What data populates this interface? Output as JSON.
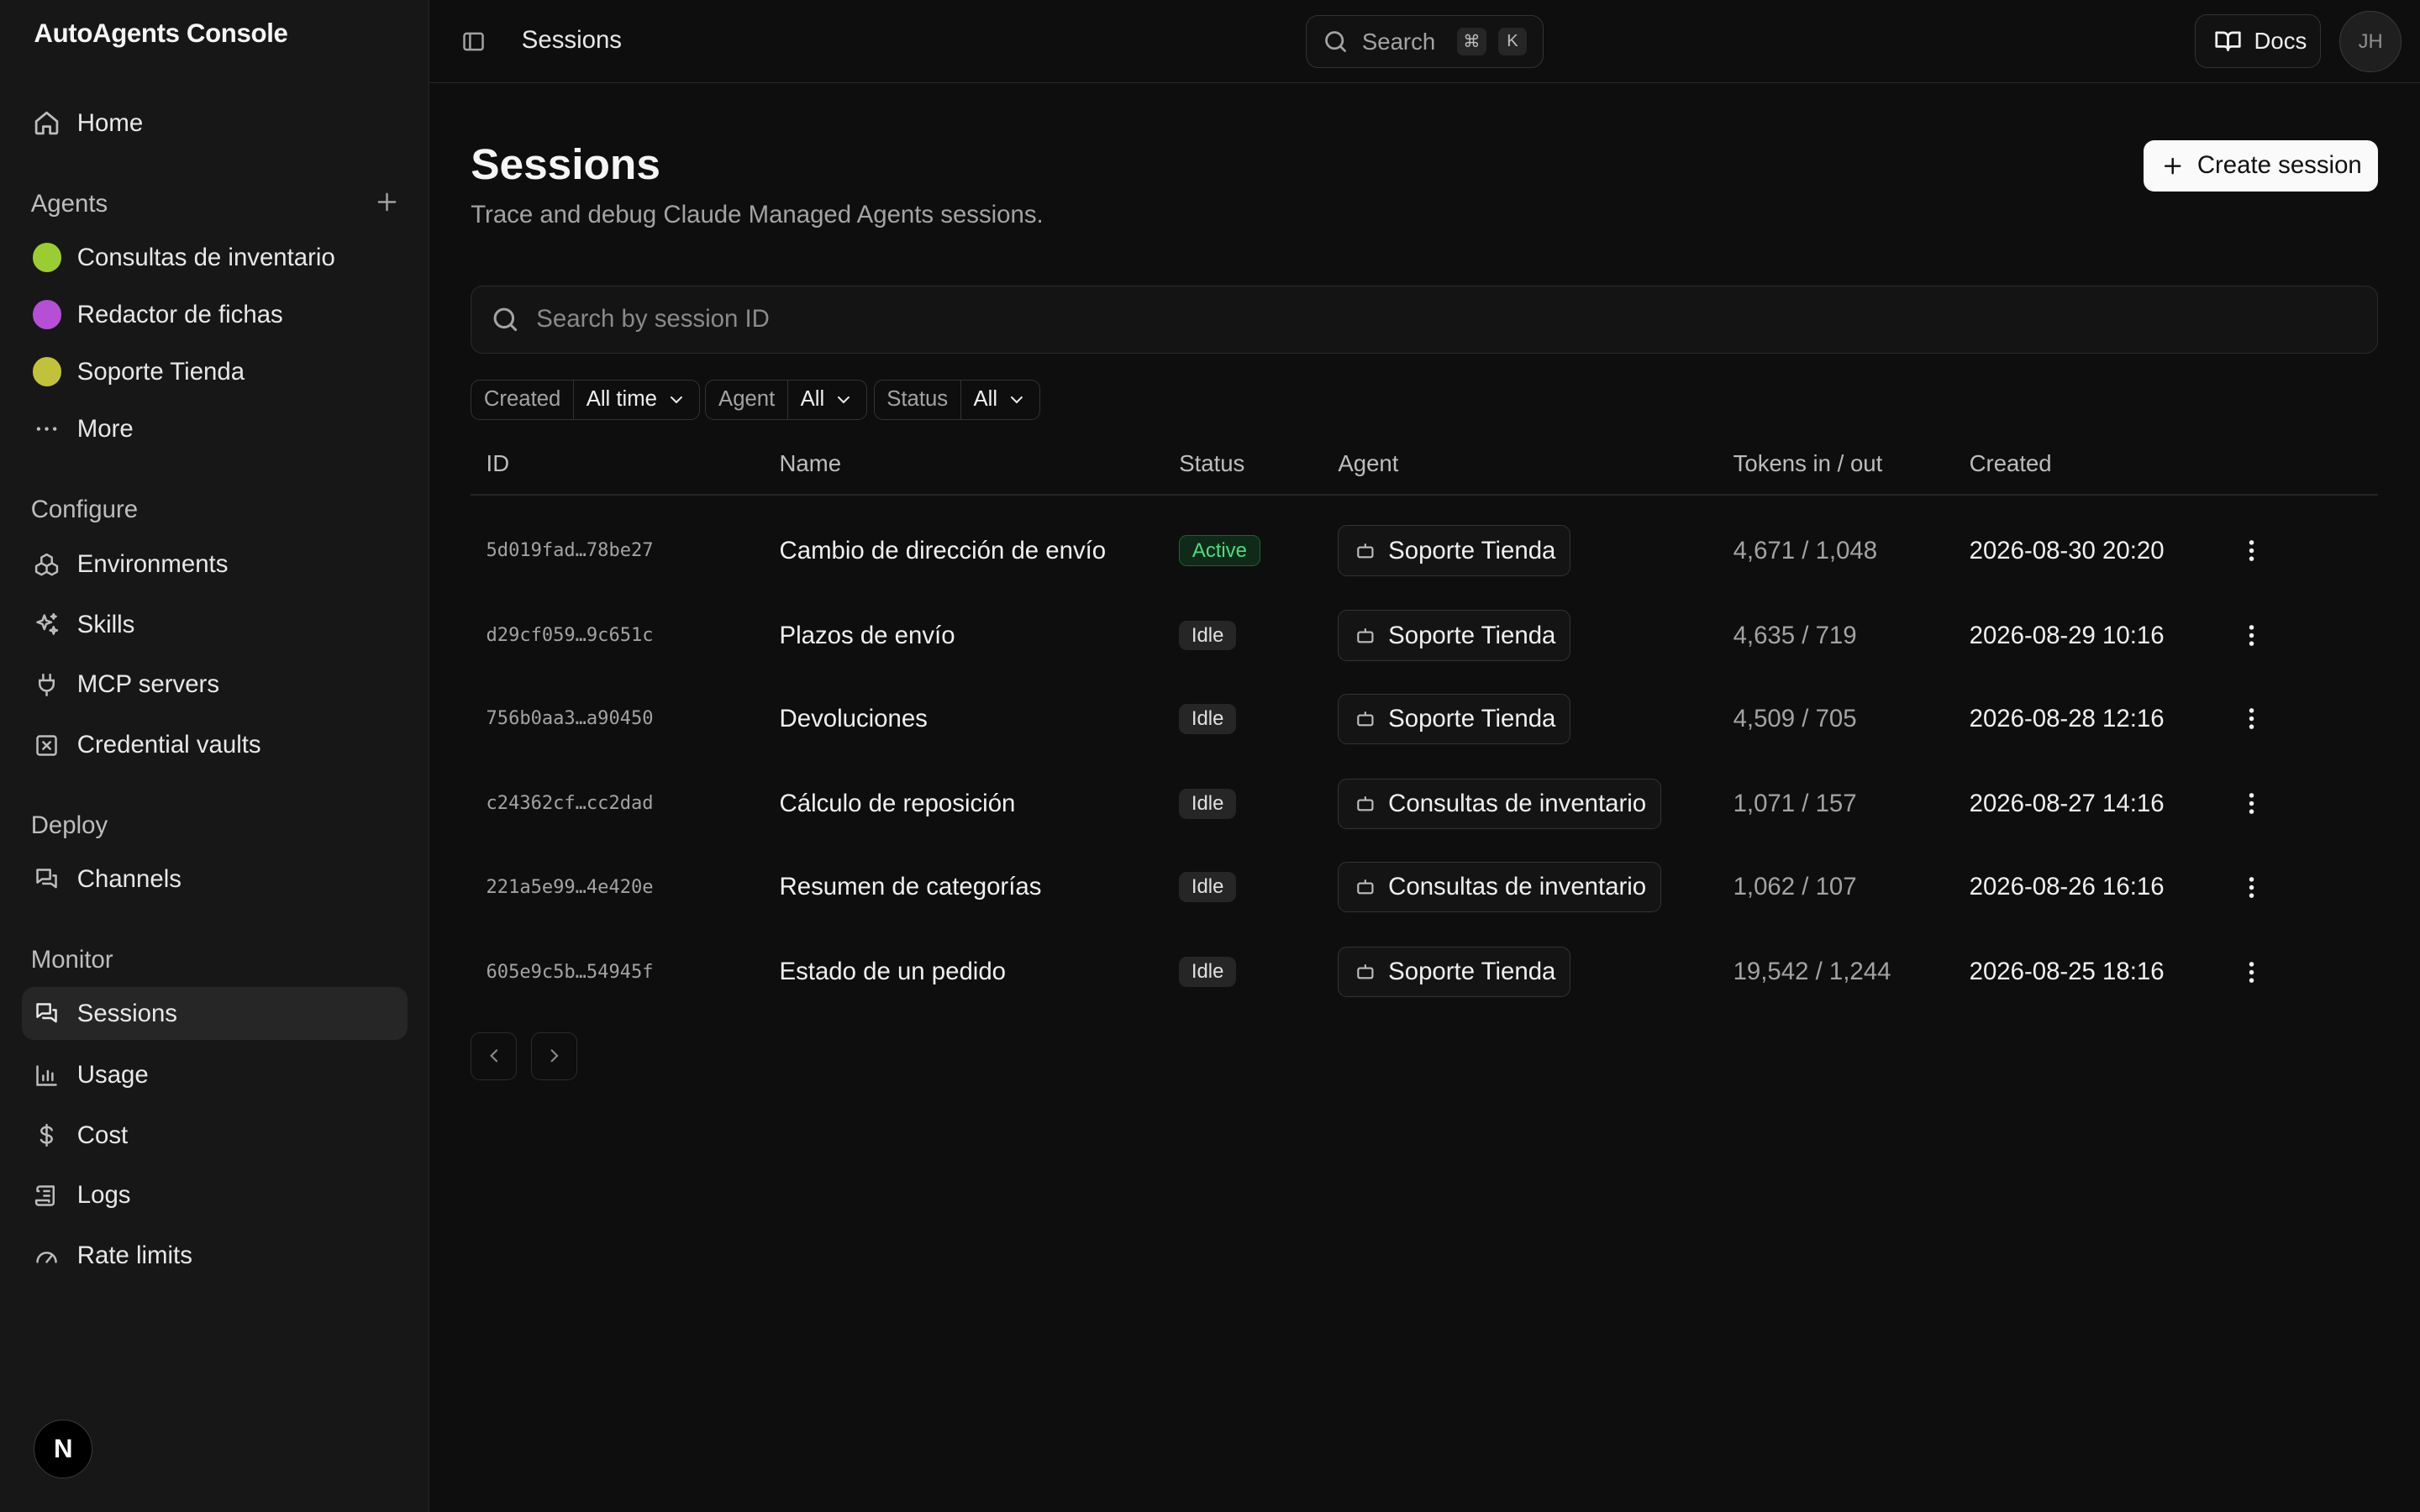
{
  "app": {
    "title": "AutoAgents Console"
  },
  "sidebar": {
    "home_label": "Home",
    "agents_title": "Agents",
    "agents": [
      {
        "label": "Consultas de inventario",
        "color": "#9acd32"
      },
      {
        "label": "Redactor de fichas",
        "color": "#b44fd6"
      },
      {
        "label": "Soporte Tienda",
        "color": "#c2c23a"
      }
    ],
    "more_label": "More",
    "configure_title": "Configure",
    "configure_items": [
      "Environments",
      "Skills",
      "MCP servers",
      "Credential vaults"
    ],
    "deploy_title": "Deploy",
    "deploy_items": [
      "Channels"
    ],
    "monitor_title": "Monitor",
    "monitor_items": [
      "Sessions",
      "Usage",
      "Cost",
      "Logs",
      "Rate limits"
    ],
    "badge_letter": "N"
  },
  "topbar": {
    "breadcrumb": "Sessions",
    "search_label": "Search",
    "search_kbd1": "⌘",
    "search_kbd2": "K",
    "docs_label": "Docs",
    "avatar_initials": "JH"
  },
  "page": {
    "title": "Sessions",
    "subtitle": "Trace and debug Claude Managed Agents sessions.",
    "create_label": "Create session",
    "search_placeholder": "Search by session ID"
  },
  "filters": [
    {
      "label": "Created",
      "value": "All time"
    },
    {
      "label": "Agent",
      "value": "All"
    },
    {
      "label": "Status",
      "value": "All"
    }
  ],
  "table": {
    "columns": [
      "ID",
      "Name",
      "Status",
      "Agent",
      "Tokens in / out",
      "Created"
    ],
    "rows": [
      {
        "id": "5d019fad…78be27",
        "name": "Cambio de dirección de envío",
        "status": "Active",
        "agent": "Soporte Tienda",
        "tokens": "4,671 / 1,048",
        "created": "2026-08-30 20:20"
      },
      {
        "id": "d29cf059…9c651c",
        "name": "Plazos de envío",
        "status": "Idle",
        "agent": "Soporte Tienda",
        "tokens": "4,635 / 719",
        "created": "2026-08-29 10:16"
      },
      {
        "id": "756b0aa3…a90450",
        "name": "Devoluciones",
        "status": "Idle",
        "agent": "Soporte Tienda",
        "tokens": "4,509 / 705",
        "created": "2026-08-28 12:16"
      },
      {
        "id": "c24362cf…cc2dad",
        "name": "Cálculo de reposición",
        "status": "Idle",
        "agent": "Consultas de inventario",
        "tokens": "1,071 / 157",
        "created": "2026-08-27 14:16"
      },
      {
        "id": "221a5e99…4e420e",
        "name": "Resumen de categorías",
        "status": "Idle",
        "agent": "Consultas de inventario",
        "tokens": "1,062 / 107",
        "created": "2026-08-26 16:16"
      },
      {
        "id": "605e9c5b…54945f",
        "name": "Estado de un pedido",
        "status": "Idle",
        "agent": "Soporte Tienda",
        "tokens": "19,542 / 1,244",
        "created": "2026-08-25 18:16"
      }
    ]
  }
}
